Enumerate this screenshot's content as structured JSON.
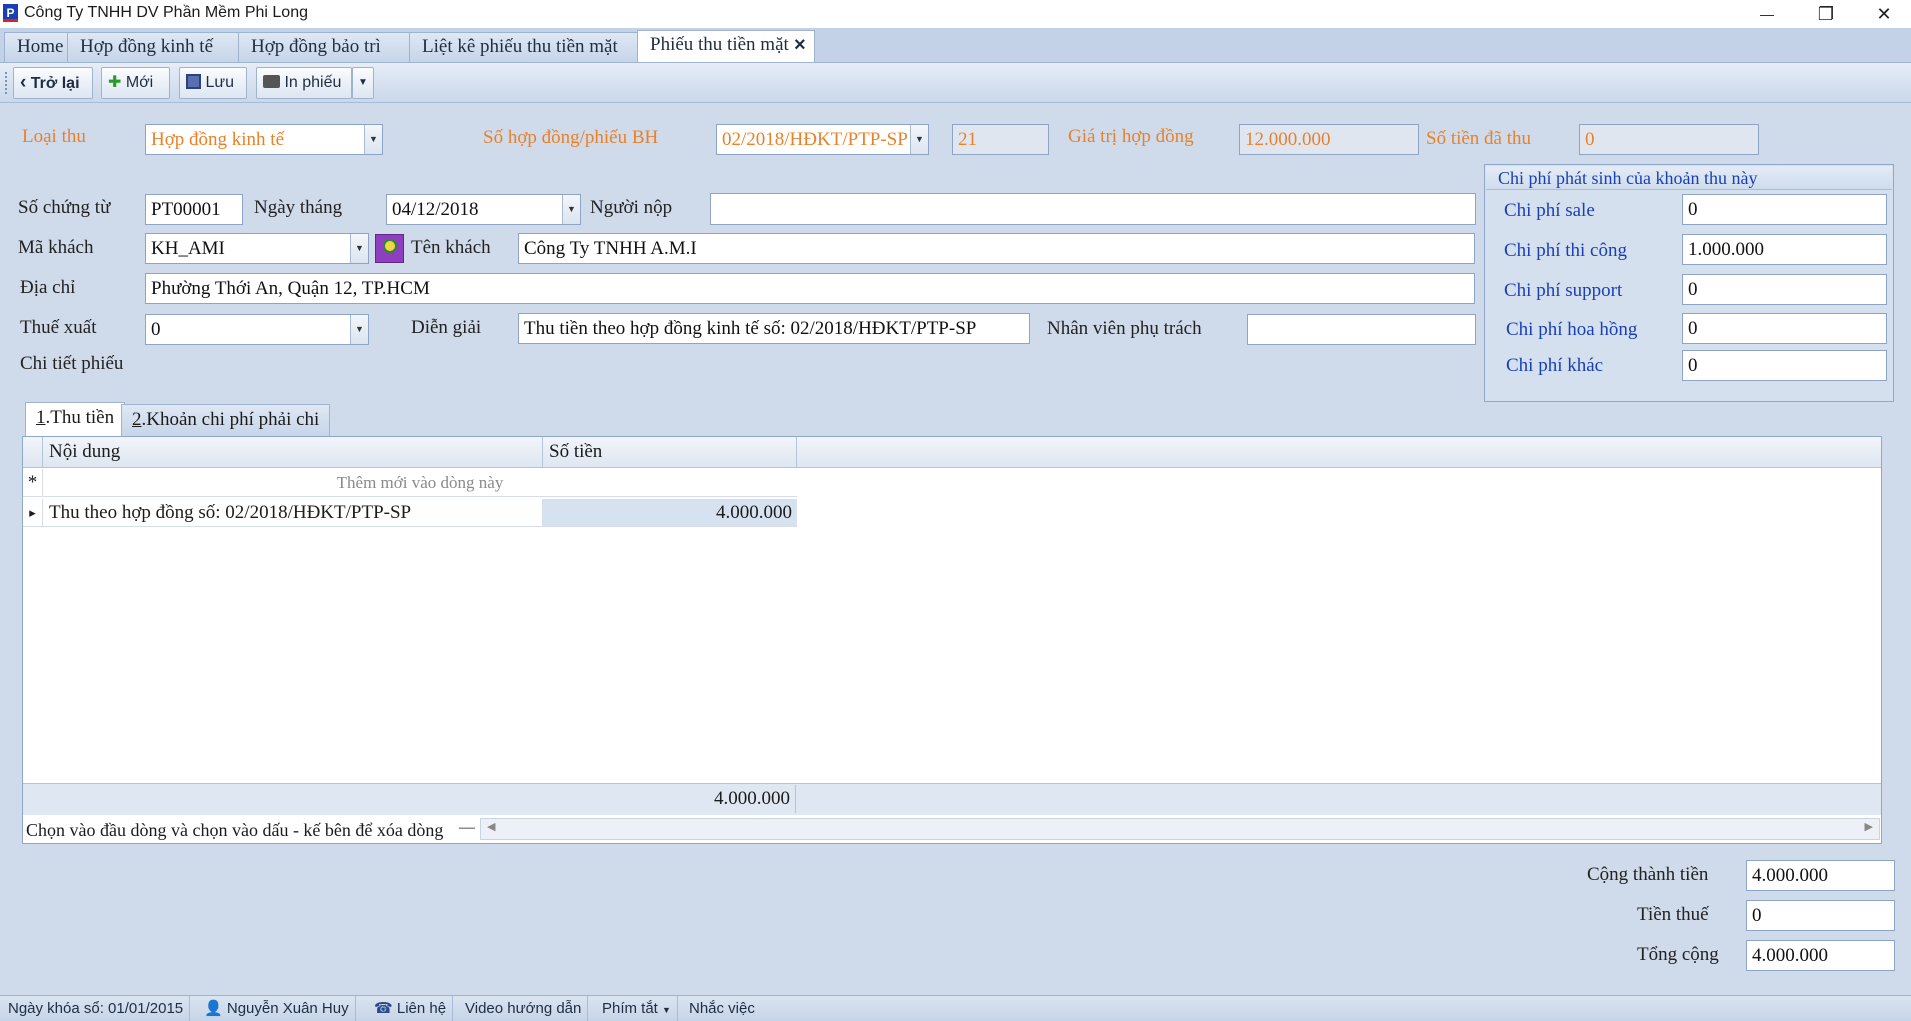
{
  "window": {
    "title": "Công Ty TNHH DV Phần Mềm Phi Long",
    "minimize": "—",
    "restore": "❐",
    "close": "✕"
  },
  "tabs": [
    {
      "label": "Home"
    },
    {
      "label": "Hợp đồng kinh tế"
    },
    {
      "label": "Hợp đồng bảo trì"
    },
    {
      "label": "Liệt kê phiếu thu tiền mặt"
    },
    {
      "label": "Phiếu thu tiền mặt",
      "active": true,
      "close": "×"
    }
  ],
  "toolbar": {
    "back": "Trở lại",
    "new": "Mới",
    "save": "Lưu",
    "print": "In phiếu"
  },
  "form": {
    "loai_thu_label": "Loại thu",
    "loai_thu_value": "Hợp đồng kinh tế",
    "so_hd_label": "Số hợp đồng/phiếu BH",
    "so_hd_value": "02/2018/HĐKT/PTP-SP",
    "so_hd_num": "21",
    "gia_tri_label": "Giá trị hợp đồng",
    "gia_tri_value": "12.000.000",
    "da_thu_label": "Số tiền đã thu",
    "da_thu_value": "0",
    "so_ct_label": "Số chứng từ",
    "so_ct_value": "PT00001",
    "ngay_label": "Ngày tháng",
    "ngay_value": "04/12/2018",
    "nguoi_nop_label": "Người nộp",
    "nguoi_nop_value": "",
    "ma_khach_label": "Mã khách",
    "ma_khach_value": "KH_AMI",
    "ten_khach_label": "Tên khách",
    "ten_khach_value": "Công Ty TNHH A.M.I",
    "dia_chi_label": "Địa chỉ",
    "dia_chi_value": "Phường Thới An, Quận 12, TP.HCM",
    "thue_label": "Thuế xuất",
    "thue_value": "0",
    "dien_giai_label": "Diễn giải",
    "dien_giai_value": "Thu tiền theo hợp đồng kinh tế số: 02/2018/HĐKT/PTP-SP",
    "nhan_vien_label": "Nhân viên phụ trách",
    "nhan_vien_value": "",
    "chi_tiet_label": "Chi tiết phiếu"
  },
  "costs": {
    "title": "Chi phí phát sinh của khoản thu này",
    "items": [
      {
        "label": "Chi phí sale",
        "value": "0"
      },
      {
        "label": "Chi phí thi công",
        "value": "1.000.000"
      },
      {
        "label": "Chi phí support",
        "value": "0"
      },
      {
        "label": "Chi phí hoa hồng",
        "value": "0"
      },
      {
        "label": "Chi phí khác",
        "value": "0"
      }
    ]
  },
  "detail_tabs": {
    "tab1_num": "1",
    "tab1_rest": ".Thu tiền",
    "tab2_num": "2",
    "tab2_rest": ".Khoản chi phí phải chi"
  },
  "grid": {
    "columns": [
      "Nội dung",
      "Số tiền"
    ],
    "new_row": "Thêm mới vào dòng này",
    "new_marker": "*",
    "rows": [
      {
        "marker": "▸",
        "noi_dung": "Thu theo hợp đồng số: 02/2018/HĐKT/PTP-SP",
        "so_tien": "4.000.000"
      }
    ],
    "footer_total": "4.000.000",
    "hint": "Chọn vào đầu dòng và chọn vào dấu - kế bên để xóa dòng",
    "hint_minus": "—"
  },
  "totals": {
    "cong_label": "Cộng thành tiền",
    "cong_value": "4.000.000",
    "thue_label": "Tiền thuế",
    "thue_value": "0",
    "tong_label": "Tổng cộng",
    "tong_value": "4.000.000"
  },
  "status": {
    "lock_date": "Ngày khóa sổ: 01/01/2015",
    "user": "Nguyễn Xuân Huy",
    "contact": "Liên hệ",
    "video": "Video hướng dẫn",
    "shortcut": "Phím tắt",
    "remind": "Nhắc việc"
  }
}
